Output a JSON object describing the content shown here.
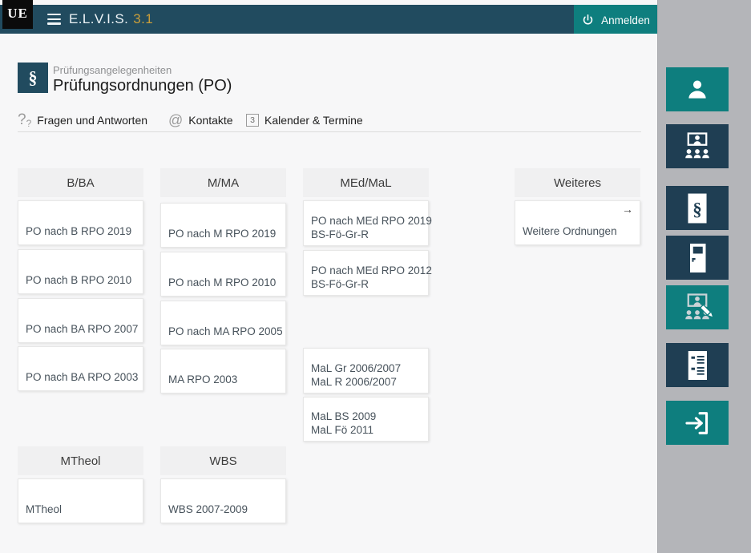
{
  "topbar": {
    "logo": "UE",
    "app_title": "E.L.V.I.S.",
    "app_version": "3.1",
    "login_button": {
      "label": "Anmelden"
    }
  },
  "page_header": {
    "icon_glyph": "§",
    "eyebrow": "Prüfungsangelegenheiten",
    "title": "Prüfungsordnungen (PO)"
  },
  "quicklinks": [
    {
      "icon": "question-icon",
      "glyph": "?",
      "glyph_small": "?",
      "label": "Fragen und Antworten"
    },
    {
      "icon": "at-icon",
      "glyph": "@",
      "label": "Kontakte"
    },
    {
      "icon": "calendar-icon",
      "badge": "3",
      "label": "Kalender & Termine"
    }
  ],
  "board": {
    "columns": [
      {
        "header": "B/BA",
        "cards": [
          {
            "lines": [
              "PO nach B RPO 2019"
            ]
          },
          {
            "lines": [
              "PO nach B RPO 2010"
            ]
          },
          {
            "lines": [
              "PO nach BA RPO 2007"
            ]
          },
          {
            "lines": [
              "PO nach BA RPO 2003"
            ]
          }
        ]
      },
      {
        "header": "M/MA",
        "cards": [
          {
            "lines": [
              "PO nach M RPO 2019"
            ]
          },
          {
            "lines": [
              "PO nach M RPO 2010"
            ]
          },
          {
            "lines": [
              "PO nach MA RPO 2005"
            ]
          },
          {
            "lines": [
              "MA RPO 2003"
            ]
          }
        ]
      },
      {
        "header": "MEd/MaL",
        "cards": [
          {
            "lines": [
              "PO nach MEd RPO 2019",
              "BS-Fö-Gr-R"
            ]
          },
          {
            "lines": [
              "PO nach MEd RPO 2012",
              "BS-Fö-Gr-R"
            ]
          },
          {
            "lines": [
              "MaL Gr 2006/2007",
              "MaL R 2006/2007"
            ]
          },
          {
            "lines": [
              "MaL BS 2009",
              "MaL Fö 2011"
            ]
          }
        ]
      },
      {
        "header": "Weiteres",
        "cards": [
          {
            "lines": [
              "Weitere Ordnungen"
            ],
            "arrow": "→"
          }
        ]
      },
      {
        "header": "MTheol",
        "cards": [
          {
            "lines": [
              "MTheol"
            ]
          }
        ]
      },
      {
        "header": "WBS",
        "cards": [
          {
            "lines": [
              "WBS 2007-2009"
            ]
          }
        ]
      }
    ]
  },
  "sidebar": {
    "buttons": [
      {
        "icon": "user-icon",
        "style": "teal"
      },
      {
        "icon": "meeting-icon",
        "style": "navy"
      },
      {
        "icon": "paragraph-doc-icon",
        "style": "navy",
        "glyph": "§"
      },
      {
        "icon": "door-icon",
        "style": "navy"
      },
      {
        "icon": "edit-meeting-icon",
        "style": "teal"
      },
      {
        "icon": "report-icon",
        "style": "navy"
      },
      {
        "icon": "login-icon",
        "style": "teal"
      }
    ]
  },
  "colors": {
    "topbar_navy": "#214b5f",
    "button_navy": "#1f3e53",
    "teal": "#0e7e7e",
    "gold": "#c99e3a",
    "sidebar_gray": "#b4b5b9",
    "content_bg": "#f7f7f8"
  }
}
